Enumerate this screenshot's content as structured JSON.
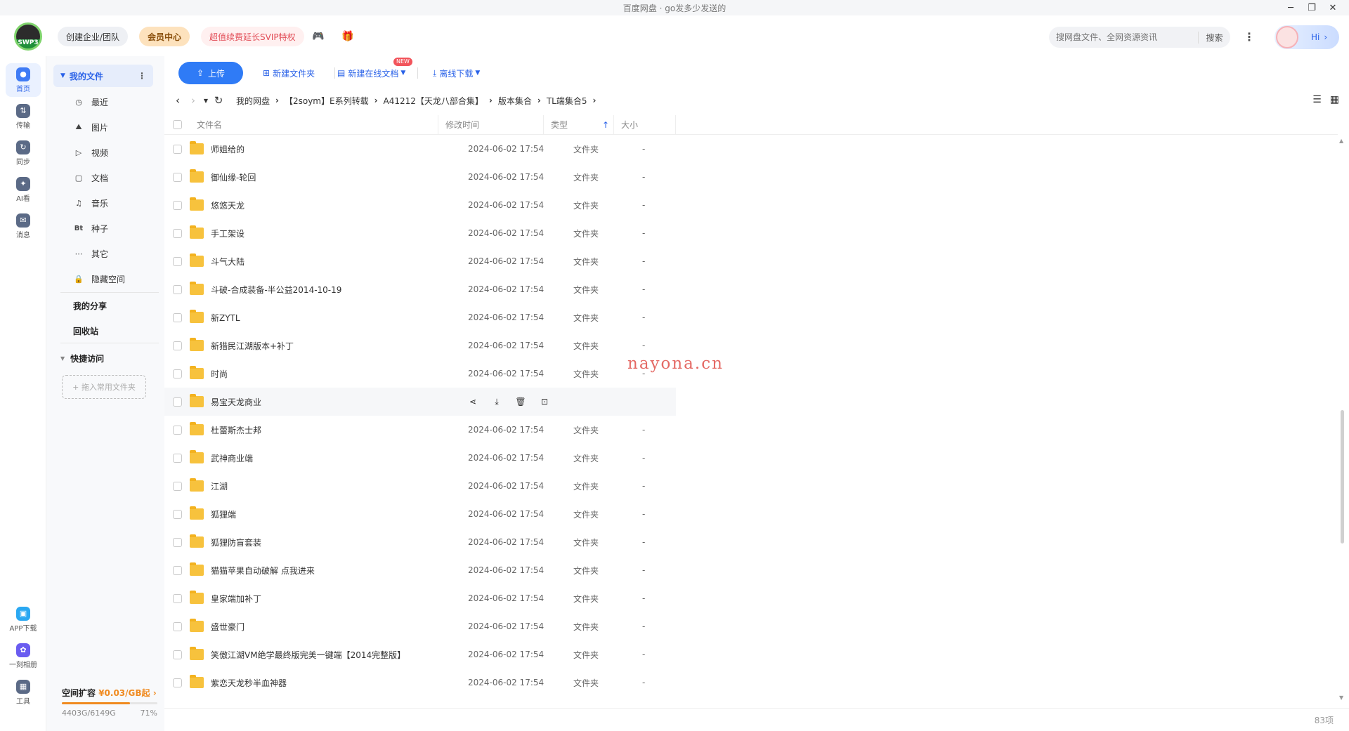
{
  "window": {
    "title": "百度网盘 · go发多少发送的",
    "min": "─",
    "restore": "❐",
    "close": "✕"
  },
  "header": {
    "logo_text": "SWP3",
    "team": "创建企业/团队",
    "vip": "会员中心",
    "svip": "超值续费延长SVIP特权",
    "search_placeholder": "搜网盘文件、全网资源资讯",
    "search_button": "搜索",
    "greeting": "Hi"
  },
  "rail": [
    {
      "label": "首页",
      "icon": "home-icon",
      "glyph": "●"
    },
    {
      "label": "传输",
      "icon": "transfer-icon",
      "glyph": "⇅"
    },
    {
      "label": "同步",
      "icon": "sync-icon",
      "glyph": "↻"
    },
    {
      "label": "AI看",
      "icon": "ai-icon",
      "glyph": "✦"
    },
    {
      "label": "消息",
      "icon": "message-icon",
      "glyph": "✉"
    },
    {
      "label": "APP下载",
      "icon": "app-download-icon",
      "glyph": "▣"
    },
    {
      "label": "一刻相册",
      "icon": "album-icon",
      "glyph": "✿"
    },
    {
      "label": "工具",
      "icon": "tools-icon",
      "glyph": "▦"
    }
  ],
  "sidebar": {
    "my_files": "我的文件",
    "items": [
      {
        "label": "最近",
        "glyph": "◷"
      },
      {
        "label": "图片",
        "glyph": "⛰"
      },
      {
        "label": "视频",
        "glyph": "▷"
      },
      {
        "label": "文档",
        "glyph": "▢"
      },
      {
        "label": "音乐",
        "glyph": "♫"
      },
      {
        "label": "种子",
        "glyph": "Bt"
      },
      {
        "label": "其它",
        "glyph": "⋯"
      },
      {
        "label": "隐藏空间",
        "glyph": "🔒"
      }
    ],
    "my_share": "我的分享",
    "recycle": "回收站",
    "quick_access": "快捷访问",
    "drop_hint": "+ 拖入常用文件夹",
    "storage_title": "空间扩容",
    "storage_promo": "¥0.03/GB起",
    "storage_used": "4403G/6149G",
    "storage_percent": "71%",
    "storage_fraction": 0.71
  },
  "toolbar": {
    "upload": "上传",
    "new_folder": "新建文件夹",
    "new_online_doc": "新建在线文档",
    "new_badge": "NEW",
    "offline_download": "离线下载"
  },
  "breadcrumb": [
    "我的网盘",
    "【2soym】E系列转载",
    "A41212【天龙八部合集】",
    "版本集合",
    "TL端集合5"
  ],
  "columns": {
    "name": "文件名",
    "time": "修改时间",
    "type": "类型",
    "size": "大小"
  },
  "files": [
    {
      "name": "师姐给的",
      "time": "2024-06-02 17:54",
      "type": "文件夹",
      "size": "-"
    },
    {
      "name": "御仙缘-轮回",
      "time": "2024-06-02 17:54",
      "type": "文件夹",
      "size": "-"
    },
    {
      "name": "悠悠天龙",
      "time": "2024-06-02 17:54",
      "type": "文件夹",
      "size": "-"
    },
    {
      "name": "手工架设",
      "time": "2024-06-02 17:54",
      "type": "文件夹",
      "size": "-"
    },
    {
      "name": "斗气大陆",
      "time": "2024-06-02 17:54",
      "type": "文件夹",
      "size": "-"
    },
    {
      "name": "斗破-合成装备-半公益2014-10-19",
      "time": "2024-06-02 17:54",
      "type": "文件夹",
      "size": "-"
    },
    {
      "name": "新ZYTL",
      "time": "2024-06-02 17:54",
      "type": "文件夹",
      "size": "-"
    },
    {
      "name": "新猎民江湖版本+补丁",
      "time": "2024-06-02 17:54",
      "type": "文件夹",
      "size": "-"
    },
    {
      "name": "时尚",
      "time": "2024-06-02 17:54",
      "type": "文件夹",
      "size": "-"
    },
    {
      "name": "易宝天龙商业",
      "time": "",
      "type": "",
      "size": "",
      "hover": true
    },
    {
      "name": "杜蕾斯杰士邦",
      "time": "2024-06-02 17:54",
      "type": "文件夹",
      "size": "-"
    },
    {
      "name": "武神商业端",
      "time": "2024-06-02 17:54",
      "type": "文件夹",
      "size": "-"
    },
    {
      "name": "江湖",
      "time": "2024-06-02 17:54",
      "type": "文件夹",
      "size": "-"
    },
    {
      "name": "狐狸端",
      "time": "2024-06-02 17:54",
      "type": "文件夹",
      "size": "-"
    },
    {
      "name": "狐狸防盲套装",
      "time": "2024-06-02 17:54",
      "type": "文件夹",
      "size": "-"
    },
    {
      "name": "猫猫苹果自动破解 点我进来",
      "time": "2024-06-02 17:54",
      "type": "文件夹",
      "size": "-"
    },
    {
      "name": "皇家端加补丁",
      "time": "2024-06-02 17:54",
      "type": "文件夹",
      "size": "-"
    },
    {
      "name": "盛世豪门",
      "time": "2024-06-02 17:54",
      "type": "文件夹",
      "size": "-"
    },
    {
      "name": "笑傲江湖VM绝学最终版完美一键端【2014完整版】",
      "time": "2024-06-02 17:54",
      "type": "文件夹",
      "size": "-"
    },
    {
      "name": "紫恋天龙秒半血神器",
      "time": "2024-06-02 17:54",
      "type": "文件夹",
      "size": "-"
    }
  ],
  "row_actions": [
    {
      "icon": "share-icon",
      "glyph": "⋖"
    },
    {
      "icon": "download-icon",
      "glyph": "⤓"
    },
    {
      "icon": "delete-icon",
      "glyph": "🗑"
    },
    {
      "icon": "more-actions-icon",
      "glyph": "⊡"
    }
  ],
  "footer": {
    "count": "83项"
  },
  "watermark": "nayona.cn",
  "colors": {
    "accent": "#2f7bf6",
    "folder": "#f7c23d",
    "vip": "#fde2bd",
    "svip_text": "#e24c56"
  }
}
